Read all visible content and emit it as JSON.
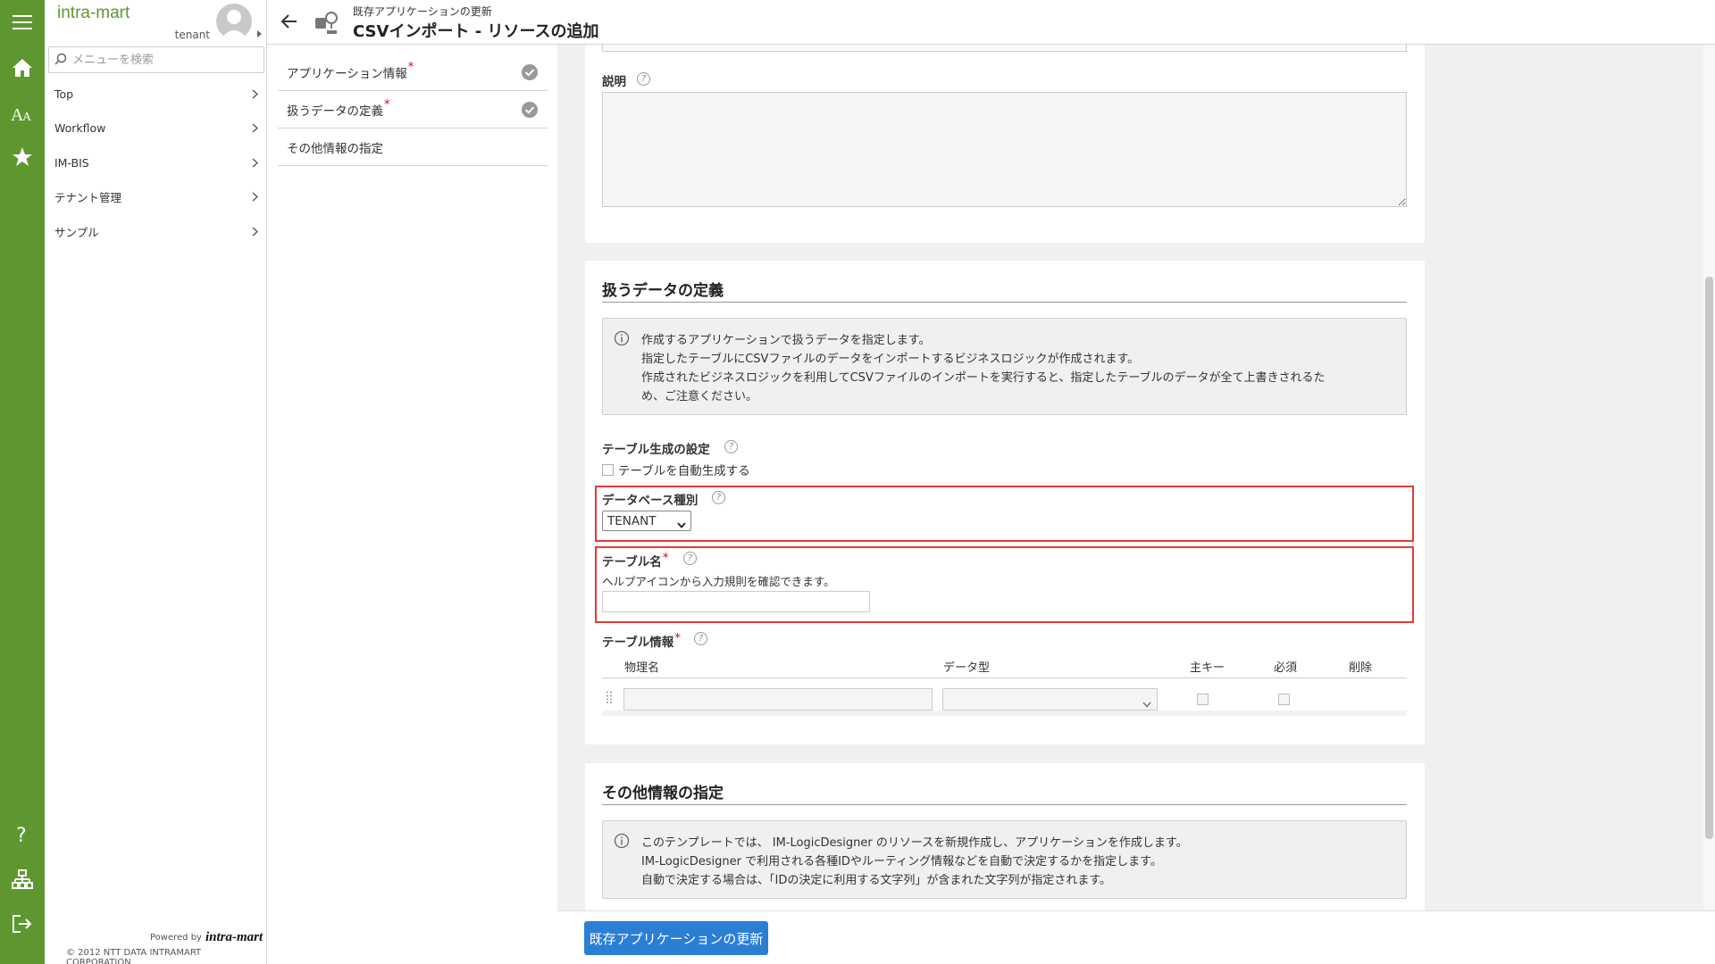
{
  "brand": "intra-mart",
  "user": {
    "tenant": "tenant"
  },
  "search": {
    "placeholder": "メニューを検索",
    "value": ""
  },
  "menu": [
    {
      "label": "Top"
    },
    {
      "label": "Workflow"
    },
    {
      "label": "IM-BIS"
    },
    {
      "label": "テナント管理"
    },
    {
      "label": "サンプル"
    }
  ],
  "rail_icons": [
    "menu-icon",
    "home-icon",
    "font-icon",
    "star-icon",
    "help-icon",
    "sitemap-icon",
    "logout-icon"
  ],
  "footer_brand": {
    "powered": "Powered by",
    "logo": "intra-mart",
    "copyright": "© 2012 NTT DATA INTRAMART CORPORATION"
  },
  "header": {
    "subtitle": "既存アプリケーションの更新",
    "title": "CSVインポート - リソースの追加"
  },
  "steps": [
    {
      "label": "アプリケーション情報",
      "required": "*",
      "done": true
    },
    {
      "label": "扱うデータの定義",
      "required": "*",
      "done": true
    },
    {
      "label": "その他情報の指定",
      "required": "",
      "done": false
    }
  ],
  "form": {
    "description_label": "説明",
    "data_section_title": "扱うデータの定義",
    "data_info": [
      "作成するアプリケーションで扱うデータを指定します。",
      "指定したテーブルにCSVファイルのデータをインポートするビジネスロジックが作成されます。",
      "作成されたビジネスロジックを利用してCSVファイルのインポートを実行すると、指定したテーブルのデータが全て上書きされるた",
      "め、ご注意ください。"
    ],
    "table_gen_label": "テーブル生成の設定",
    "table_gen_checkbox": "テーブルを自動生成する",
    "db_type_label": "データベース種別",
    "db_type_value": "TENANT",
    "table_name_label": "テーブル名",
    "table_name_required": "*",
    "table_name_hint": "ヘルプアイコンから入力規則を確認できます。",
    "table_info_label": "テーブル情報",
    "table_info_required": "*",
    "table_columns": [
      "物理名",
      "データ型",
      "主キー",
      "必須",
      "削除"
    ],
    "other_section_title": "その他情報の指定",
    "other_info": [
      "このテンプレートでは、 IM-LogicDesigner のリソースを新規作成し、アプリケーションを作成します。",
      "IM-LogicDesigner で利用される各種IDやルーティング情報などを自動で決定するかを指定します。",
      "自動で決定する場合は、「IDの決定に利用する文字列」が含まれた文字列が指定されます。"
    ]
  },
  "footer": {
    "update_button": "既存アプリケーションの更新"
  },
  "colors": {
    "rail": "#5e9730",
    "accent": "#2a7fd4",
    "required": "#e60012",
    "highlight": "#e53935"
  }
}
